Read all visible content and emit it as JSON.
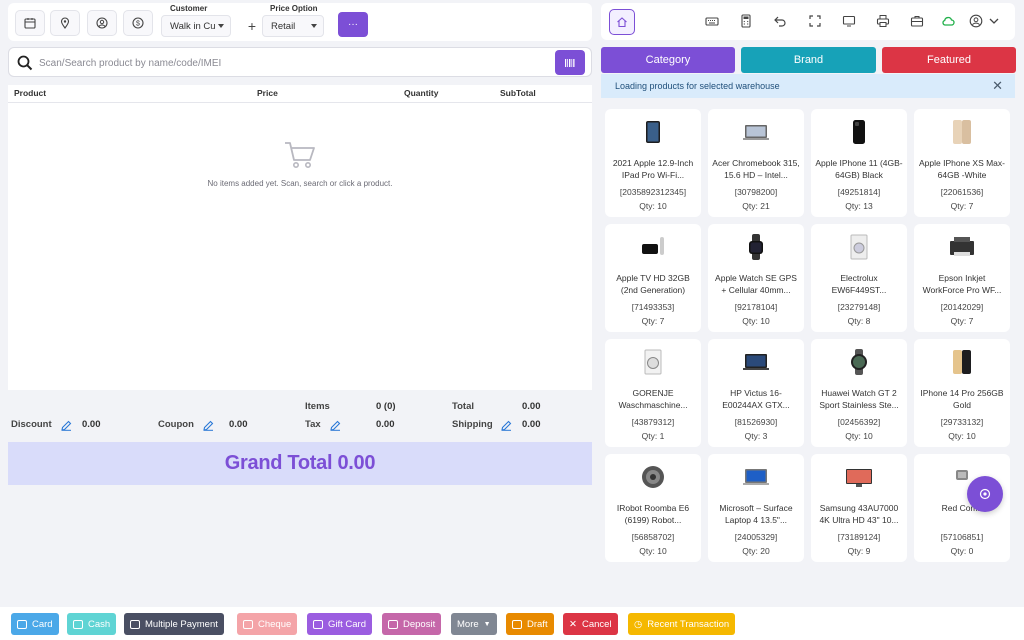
{
  "header": {
    "customer_label": "Customer",
    "customer_value": "Walk in Cu",
    "price_label": "Price Option",
    "price_value": "Retail",
    "more_label": "···",
    "icons": [
      "calendar-icon",
      "location-icon",
      "user-icon",
      "dollar-icon",
      "plus-icon"
    ]
  },
  "search": {
    "placeholder": "Scan/Search product by name/code/IMEI"
  },
  "cart": {
    "columns": {
      "product": "Product",
      "price": "Price",
      "quantity": "Quantity",
      "subtotal": "SubTotal"
    },
    "empty_message": "No items added yet. Scan, search or click a product."
  },
  "totals": {
    "items_label": "Items",
    "items_value": "0 (0)",
    "total_label": "Total",
    "total_value": "0.00",
    "discount_label": "Discount",
    "discount_value": "0.00",
    "coupon_label": "Coupon",
    "coupon_value": "0.00",
    "tax_label": "Tax",
    "tax_value": "0.00",
    "shipping_label": "Shipping",
    "shipping_value": "0.00",
    "grand_total": "Grand Total 0.00"
  },
  "tabs": {
    "category": "Category",
    "brand": "Brand",
    "featured": "Featured"
  },
  "alert": {
    "message": "Loading products for selected warehouse",
    "close": "✕"
  },
  "products": [
    {
      "name": "2021 Apple 12.9-Inch IPad Pro Wi-Fi...",
      "code": "[2035892312345]",
      "qty": "Qty: 10"
    },
    {
      "name": "Acer Chromebook 315, 15.6 HD – Intel...",
      "code": "[30798200]",
      "qty": "Qty: 21"
    },
    {
      "name": "Apple IPhone 11 (4GB-64GB) Black",
      "code": "[49251814]",
      "qty": "Qty: 13"
    },
    {
      "name": "Apple IPhone XS Max-64GB -White",
      "code": "[22061536]",
      "qty": "Qty: 7"
    },
    {
      "name": "Apple TV HD 32GB (2nd Generation)",
      "code": "[71493353]",
      "qty": "Qty: 7"
    },
    {
      "name": "Apple Watch SE GPS + Cellular 40mm...",
      "code": "[92178104]",
      "qty": "Qty: 10"
    },
    {
      "name": "Electrolux EW6F449ST...",
      "code": "[23279148]",
      "qty": "Qty: 8"
    },
    {
      "name": "Epson Inkjet WorkForce Pro WF...",
      "code": "[20142029]",
      "qty": "Qty: 7"
    },
    {
      "name": "GORENJE Waschmaschine...",
      "code": "[43879312]",
      "qty": "Qty: 1"
    },
    {
      "name": "HP Victus 16-E00244AX GTX...",
      "code": "[81526930]",
      "qty": "Qty: 3"
    },
    {
      "name": "Huawei Watch GT 2 Sport Stainless Ste...",
      "code": "[02456392]",
      "qty": "Qty: 10"
    },
    {
      "name": "IPhone 14 Pro 256GB Gold",
      "code": "[29733132]",
      "qty": "Qty: 10"
    },
    {
      "name": "IRobot Roomba E6 (6199) Robot...",
      "code": "[56858702]",
      "qty": "Qty: 10"
    },
    {
      "name": "Microsoft – Surface Laptop 4 13.5\"...",
      "code": "[24005329]",
      "qty": "Qty: 20"
    },
    {
      "name": "Samsung 43AU7000 4K Ultra HD 43\" 10...",
      "code": "[73189124]",
      "qty": "Qty: 9"
    },
    {
      "name": "Red Comb",
      "code": "[57106851]",
      "qty": "Qty: 0"
    }
  ],
  "actions": {
    "card": "Card",
    "cash": "Cash",
    "multiple": "Multiple Payment",
    "cheque": "Cheque",
    "gift": "Gift Card",
    "deposit": "Deposit",
    "more": "More",
    "draft": "Draft",
    "cancel": "Cancel",
    "recent": "Recent Transaction"
  },
  "colors": {
    "accent": "#7c4fd6",
    "brand_tab": "#17a2b8",
    "featured_tab": "#dc3545",
    "grand_total_bg": "#d9dcfa",
    "alert_bg": "#d9ebfb"
  }
}
